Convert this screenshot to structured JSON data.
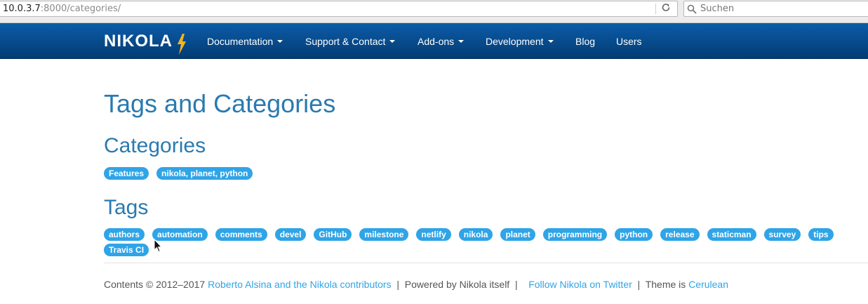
{
  "browser": {
    "url_host": "10.0.3.7",
    "url_rest": ":8000/categories/",
    "search_placeholder": "Suchen"
  },
  "navbar": {
    "brand": "NIKOLA",
    "items": [
      {
        "label": "Documentation"
      },
      {
        "label": "Support & Contact"
      },
      {
        "label": "Add-ons"
      },
      {
        "label": "Development"
      },
      {
        "label": "Blog"
      },
      {
        "label": "Users"
      }
    ]
  },
  "page": {
    "title": "Tags and Categories",
    "categories_heading": "Categories",
    "categories": [
      "Features",
      "nikola, planet, python"
    ],
    "tags_heading": "Tags",
    "tags": [
      "authors",
      "automation",
      "comments",
      "devel",
      "GitHub",
      "milestone",
      "netlify",
      "nikola",
      "planet",
      "programming",
      "python",
      "release",
      "staticman",
      "survey",
      "tips",
      "Travis CI"
    ]
  },
  "footer": {
    "contents": "Contents © 2012–2017",
    "authors_link": "Roberto Alsina and the Nikola contributors",
    "sep1": "|",
    "powered": "Powered by Nikola itself",
    "sep2": "|",
    "twitter_link": "Follow Nikola on Twitter",
    "sep3": "|",
    "theme_prefix": "Theme is",
    "theme_link": "Cerulean"
  },
  "colors": {
    "navbar_top": "#0c5ca8",
    "navbar_bottom": "#033c73",
    "heading": "#2a7ab0",
    "badge": "#2fa4e7",
    "link": "#2fa4e7"
  }
}
